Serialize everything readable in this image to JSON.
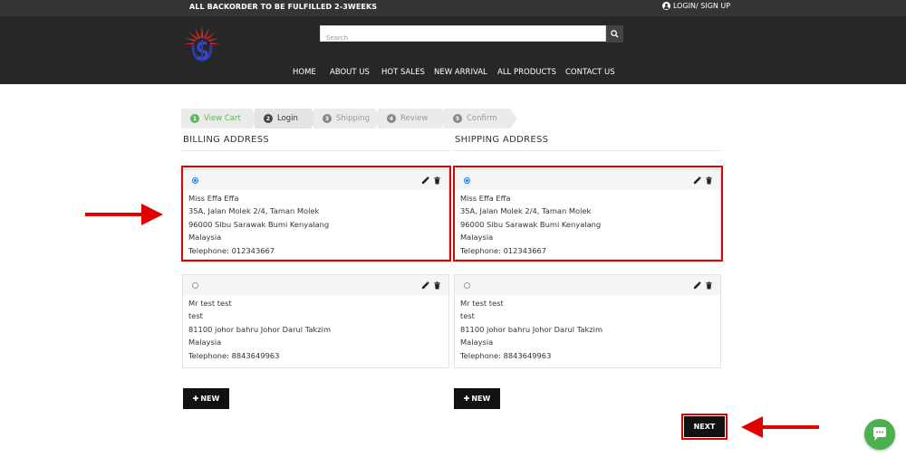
{
  "topbar": {
    "promo": "ALL BACKORDER TO BE FULFILLED 2-3WEEKS",
    "login": "LOGIN/ SIGN UP"
  },
  "header": {
    "search_placeholder": "Search",
    "nav": [
      "HOME",
      "ABOUT US",
      "HOT SALES",
      "NEW ARRIVAL",
      "ALL PRODUCTS",
      "CONTACT US"
    ]
  },
  "steps": [
    {
      "num": "1",
      "label": "View Cart"
    },
    {
      "num": "2",
      "label": "Login"
    },
    {
      "num": "3",
      "label": "Shipping"
    },
    {
      "num": "4",
      "label": "Review"
    },
    {
      "num": "5",
      "label": "Confirm"
    }
  ],
  "billing": {
    "title": "BILLING ADDRESS",
    "addresses": [
      {
        "name": "Miss Effa Effa",
        "line1": "35A, Jalan Molek 2/4, Taman Molek",
        "line2": "96000 Sibu Sarawak Bumi Kenyalang",
        "country": "Malaysia",
        "phone": "Telephone: 012343667"
      },
      {
        "name": "Mr test test",
        "line1": "test",
        "line2": "81100 johor bahru Johor Darul Takzim",
        "country": "Malaysia",
        "phone": "Telephone: 8843649963"
      }
    ],
    "new_label": "NEW"
  },
  "shipping": {
    "title": "SHIPPING ADDRESS",
    "addresses": [
      {
        "name": "Miss Effa Effa",
        "line1": "35A, Jalan Molek 2/4, Taman Molek",
        "line2": "96000 Sibu Sarawak Bumi Kenyalang",
        "country": "Malaysia",
        "phone": "Telephone: 012343667"
      },
      {
        "name": "Mr test test",
        "line1": "test",
        "line2": "81100 johor bahru Johor Darul Takzim",
        "country": "Malaysia",
        "phone": "Telephone: 8843649963"
      }
    ],
    "new_label": "NEW"
  },
  "next_label": "NEXT",
  "colors": {
    "highlight": "#e00000",
    "done": "#5cb85c",
    "radio": "#1a73e8",
    "chat": "#4caf50"
  }
}
